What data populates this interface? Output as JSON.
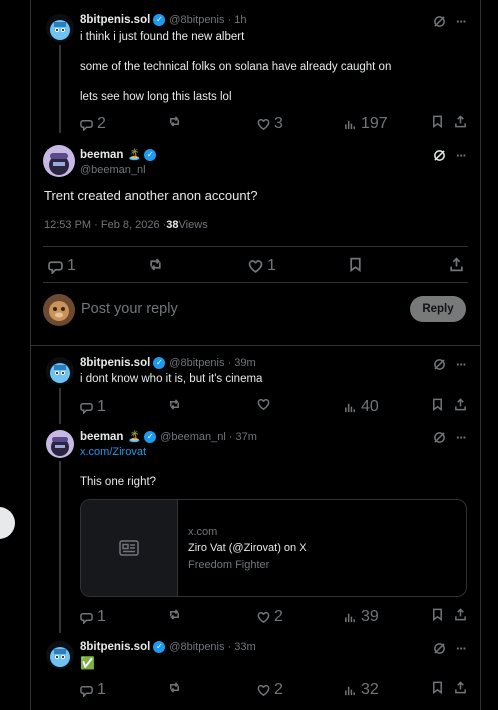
{
  "tweet1": {
    "name": "8bitpenis.sol",
    "handle": "@8bitpenis",
    "time": "· 1h",
    "lines": [
      "i think i just found the new albert",
      "some of the technical folks on solana have already caught on",
      "lets see how long this lasts lol"
    ],
    "replies": "2",
    "likes": "3",
    "views": "197"
  },
  "main": {
    "name": "beeman",
    "emoji": "🏝️",
    "handle": "@beeman_nl",
    "text": "Trent created another anon account?",
    "timestamp": "12:53 PM · Feb 8, 2026 · ",
    "views_count": "38",
    "views_label": " Views",
    "replies": "1",
    "likes": "1"
  },
  "composer": {
    "placeholder": "Post your reply",
    "button": "Reply"
  },
  "reply1": {
    "name": "8bitpenis.sol",
    "handle": "@8bitpenis",
    "time": "· 39m",
    "text": "i dont know who it is, but it's cinema",
    "replies": "1",
    "views": "40"
  },
  "reply2": {
    "name": "beeman",
    "emoji": "🏝️",
    "handle": "@beeman_nl",
    "time": "· 37m",
    "link": "x.com/Zirovat",
    "text": "This one right?",
    "card": {
      "domain": "x.com",
      "title": "Ziro Vat (@Zirovat) on X",
      "desc": "Freedom Fighter"
    },
    "replies": "1",
    "likes": "2",
    "views": "39"
  },
  "reply3": {
    "name": "8bitpenis.sol",
    "handle": "@8bitpenis",
    "time": "· 33m",
    "text": "✅",
    "replies": "1",
    "likes": "2",
    "views": "32"
  },
  "colors": {
    "accent": "#1d9bf0",
    "muted": "#71767b",
    "border": "#2f3336",
    "background": "#000000"
  }
}
